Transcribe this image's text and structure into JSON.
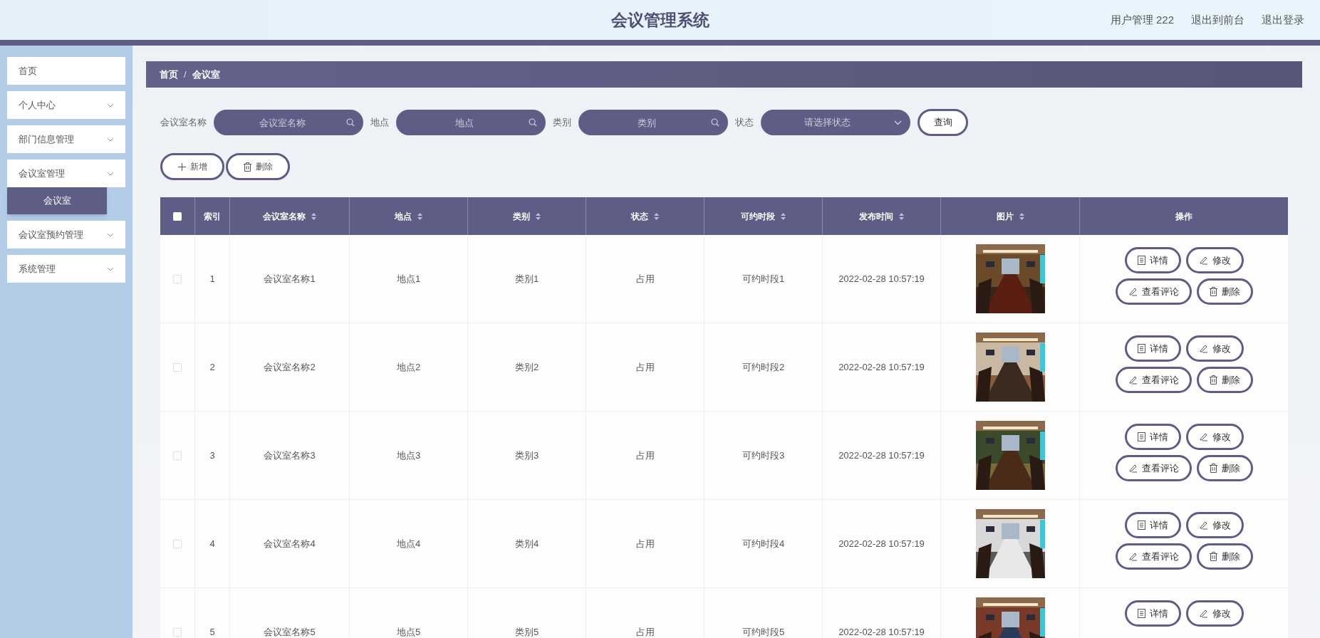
{
  "window": {
    "title": "会议管理系统"
  },
  "header_links": [
    "用户管理 222",
    "退出到前台",
    "退出登录"
  ],
  "sidebar": {
    "items": [
      {
        "label": "首页",
        "expandable": false,
        "selected": false
      },
      {
        "label": "个人中心",
        "expandable": true,
        "selected": false
      },
      {
        "label": "部门信息管理",
        "expandable": true,
        "selected": false
      },
      {
        "label": "会议室管理",
        "expandable": true,
        "selected": false,
        "children": [
          {
            "label": "会议室",
            "selected": true
          }
        ]
      },
      {
        "label": "会议室预约管理",
        "expandable": true,
        "selected": false
      },
      {
        "label": "系统管理",
        "expandable": true,
        "selected": false
      }
    ]
  },
  "breadcrumb": {
    "items": [
      "首页",
      "会议室"
    ],
    "separator": "/"
  },
  "filters": [
    {
      "label": "会议室名称",
      "placeholder": "会议室名称",
      "kind": "search"
    },
    {
      "label": "地点",
      "placeholder": "地点",
      "kind": "search"
    },
    {
      "label": "类别",
      "placeholder": "类别",
      "kind": "search"
    },
    {
      "label": "状态",
      "placeholder": "请选择状态",
      "kind": "select"
    }
  ],
  "search_button": "查询",
  "toolbar": [
    {
      "label": "新增",
      "kind": "add"
    },
    {
      "label": "删除",
      "kind": "delete"
    }
  ],
  "table": {
    "select_all": false,
    "columns": [
      {
        "label": "索引",
        "sortable": false
      },
      {
        "label": "会议室名称",
        "sortable": true
      },
      {
        "label": "地点",
        "sortable": true
      },
      {
        "label": "类别",
        "sortable": true
      },
      {
        "label": "状态",
        "sortable": true
      },
      {
        "label": "可约时段",
        "sortable": true
      },
      {
        "label": "发布时间",
        "sortable": true
      },
      {
        "label": "图片",
        "sortable": true
      },
      {
        "label": "操作",
        "sortable": false
      }
    ],
    "rows": [
      {
        "checked": false,
        "cells": [
          "1",
          "会议室名称1",
          "地点1",
          "类别1",
          "占用",
          "可约时段1",
          "2022-02-28 10:57:19"
        ],
        "picture": {
          "kind": "picture"
        },
        "actions": [
          {
            "label": "详情",
            "kind": "detail"
          },
          {
            "label": "修改",
            "kind": "edit"
          },
          {
            "label": "查看评论",
            "kind": "comment"
          },
          {
            "label": "删除",
            "kind": "delete"
          }
        ]
      },
      {
        "checked": false,
        "cells": [
          "2",
          "会议室名称2",
          "地点2",
          "类别2",
          "占用",
          "可约时段2",
          "2022-02-28 10:57:19"
        ],
        "picture": {
          "kind": "picture"
        },
        "actions": [
          {
            "label": "详情",
            "kind": "detail"
          },
          {
            "label": "修改",
            "kind": "edit"
          },
          {
            "label": "查看评论",
            "kind": "comment"
          },
          {
            "label": "删除",
            "kind": "delete"
          }
        ]
      },
      {
        "checked": false,
        "cells": [
          "3",
          "会议室名称3",
          "地点3",
          "类别3",
          "占用",
          "可约时段3",
          "2022-02-28 10:57:19"
        ],
        "picture": {
          "kind": "picture"
        },
        "actions": [
          {
            "label": "详情",
            "kind": "detail"
          },
          {
            "label": "修改",
            "kind": "edit"
          },
          {
            "label": "查看评论",
            "kind": "comment"
          },
          {
            "label": "删除",
            "kind": "delete"
          }
        ]
      },
      {
        "checked": false,
        "cells": [
          "4",
          "会议室名称4",
          "地点4",
          "类别4",
          "占用",
          "可约时段4",
          "2022-02-28 10:57:19"
        ],
        "picture": {
          "kind": "picture"
        },
        "actions": [
          {
            "label": "详情",
            "kind": "detail"
          },
          {
            "label": "修改",
            "kind": "edit"
          },
          {
            "label": "查看评论",
            "kind": "comment"
          },
          {
            "label": "删除",
            "kind": "delete"
          }
        ]
      },
      {
        "checked": false,
        "cells": [
          "5",
          "会议室名称5",
          "地点5",
          "类别5",
          "占用",
          "可约时段5",
          "2022-02-28 10:57:19"
        ],
        "picture": {
          "kind": "picture"
        },
        "actions": [
          {
            "label": "详情",
            "kind": "detail"
          },
          {
            "label": "修改",
            "kind": "edit"
          }
        ]
      }
    ]
  }
}
